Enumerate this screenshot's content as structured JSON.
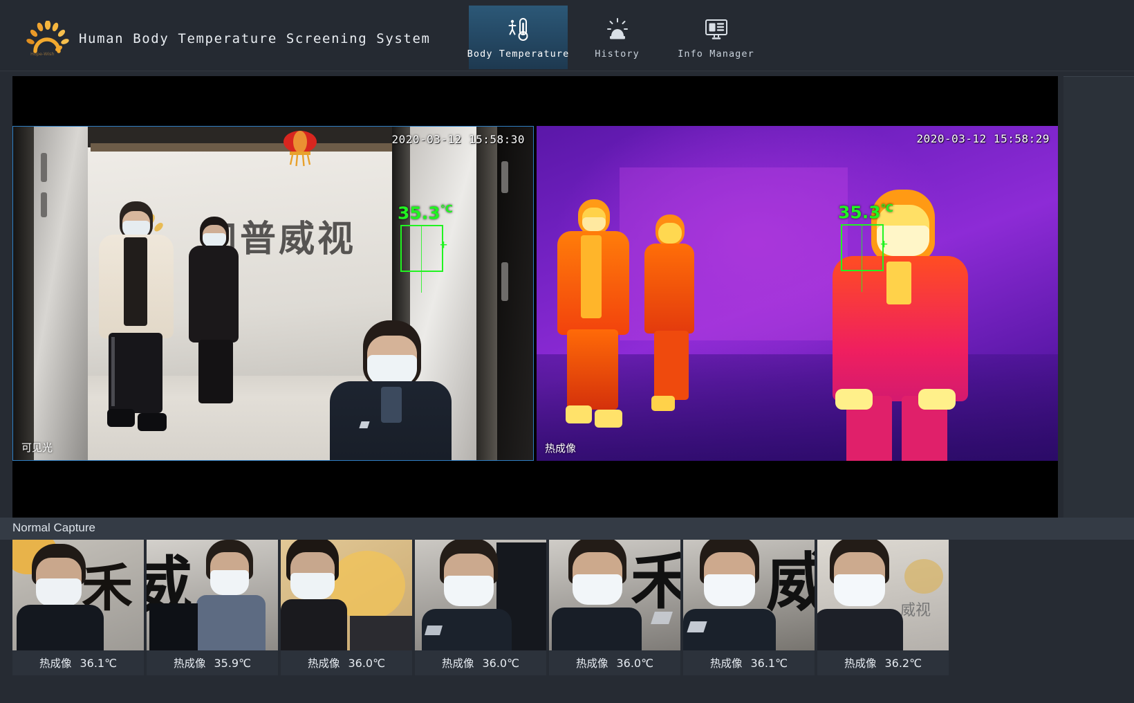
{
  "header": {
    "logo_icon": "sunburst-logo-icon",
    "logo_subtext": "Hope-Wish",
    "title": "Human Body Temperature Screening System",
    "tabs": [
      {
        "id": "body-temperature",
        "label": "Body Temperature",
        "icon": "thermometer-person-icon",
        "active": true
      },
      {
        "id": "history",
        "label": "History",
        "icon": "alarm-siren-icon",
        "active": false
      },
      {
        "id": "info-manager",
        "label": "Info Manager",
        "icon": "monitor-info-icon",
        "active": false
      }
    ]
  },
  "stage": {
    "visible_feed": {
      "name": "visible-light-feed",
      "timestamp": "2020-03-12 15:58:30",
      "tag": "可见光",
      "detection": {
        "temperature": "35.3",
        "unit": "℃",
        "color": "#21f321"
      }
    },
    "thermal_feed": {
      "name": "thermal-feed",
      "timestamp": "2020-03-12 15:58:29",
      "tag": "热成像",
      "detection": {
        "temperature": "35.3",
        "unit": "℃",
        "color": "#21f321"
      }
    }
  },
  "capture_panel": {
    "title": "Normal Capture",
    "items": [
      {
        "source": "热成像",
        "temperature": "36.1℃"
      },
      {
        "source": "热成像",
        "temperature": "35.9℃"
      },
      {
        "source": "热成像",
        "temperature": "36.0℃"
      },
      {
        "source": "热成像",
        "temperature": "36.0℃"
      },
      {
        "source": "热成像",
        "temperature": "36.0℃"
      },
      {
        "source": "热成像",
        "temperature": "36.1℃"
      },
      {
        "source": "热成像",
        "temperature": "36.2℃"
      }
    ]
  },
  "colors": {
    "accent": "#2c5877",
    "header_bg": "#252a32",
    "page_bg": "#262b33",
    "normal_temp": "#21f321",
    "panel_bg": "#343b45"
  }
}
